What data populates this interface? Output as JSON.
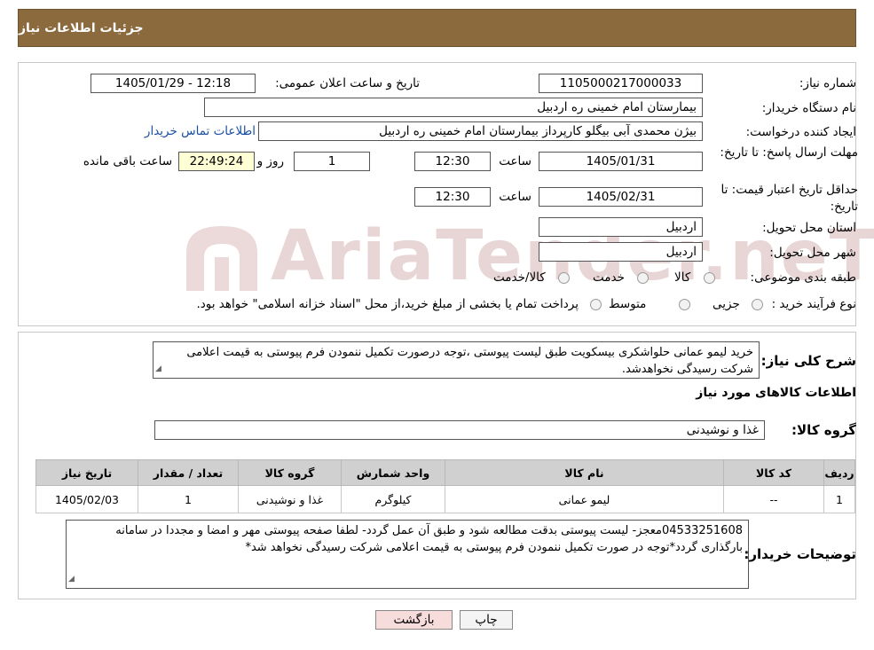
{
  "header": {
    "title": "جزئیات اطلاعات نیاز"
  },
  "form": {
    "need_number_label": "شماره نیاز:",
    "need_number": "1105000217000033",
    "announce_label": "تاریخ و ساعت اعلان عمومی:",
    "announce_value": "1405/01/29 - 12:18",
    "buyer_org_label": "نام دستگاه خریدار:",
    "buyer_org": "بیمارستان امام خمینی  ره  اردبیل",
    "creator_label": "ایجاد کننده درخواست:",
    "creator": "بیژن محمدی آبی بیگلو کارپرداز بیمارستان امام خمینی  ره  اردبیل",
    "contact_link": "اطلاعات تماس خریدار",
    "deadline_label": "مهلت ارسال پاسخ: تا تاریخ:",
    "deadline_date": "1405/01/31",
    "time_label": "ساعت",
    "deadline_time": "12:30",
    "days_value": "1",
    "days_label": "روز و",
    "remaining_time": "22:49:24",
    "remaining_label": "ساعت باقی مانده",
    "price_valid_label": "حداقل تاریخ اعتبار قیمت: تا تاریخ:",
    "price_valid_date": "1405/02/31",
    "price_valid_time": "12:30",
    "province_label": "استان محل تحویل:",
    "province": "اردبیل",
    "city_label": "شهر محل تحویل:",
    "city": "اردبیل",
    "category_label": "طبقه بندی موضوعی:",
    "category_options": [
      "کالا",
      "خدمت",
      "کالا/خدمت"
    ],
    "process_label": "نوع فرآیند خرید :",
    "process_options": [
      "جزیی",
      "متوسط"
    ],
    "process_note": "پرداخت تمام یا بخشی از مبلغ خرید،از محل \"اسناد خزانه اسلامی\" خواهد بود."
  },
  "description": {
    "label": "شرح کلی نیاز:",
    "text": "خرید لیمو عمانی حلواشکری بیسکویت طبق لیست پیوستی ،توجه درصورت تکمیل ننمودن فرم پیوستی به قیمت اعلامی شرکت رسیدگی نخواهدشد."
  },
  "goods": {
    "section_title": "اطلاعات کالاهای مورد نیاز",
    "group_label": "گروه کالا:",
    "group_value": "غذا و نوشیدنی",
    "columns": [
      "ردیف",
      "کد کالا",
      "نام کالا",
      "واحد شمارش",
      "گروه کالا",
      "تعداد / مقدار",
      "تاریخ نیاز"
    ],
    "rows": [
      [
        "1",
        "--",
        "لیمو عمانی",
        "کیلوگرم",
        "غذا و نوشیدنی",
        "1",
        "1405/02/03"
      ]
    ]
  },
  "buyer_notes": {
    "label": "توضیحات خریدار:",
    "text": "04533251608معجز- لیست پیوستی بدقت مطالعه شود و طبق آن عمل گردد- لطفا صفحه پیوستی مهر و امضا و مجددا در سامانه بارگذاری گردد*توجه در صورت تکمیل ننمودن فرم پیوستی به قیمت اعلامی شرکت رسیدگی نخواهد شد*"
  },
  "buttons": {
    "print": "چاپ",
    "back": "بازگشت"
  },
  "watermark": "AriaTender.neT",
  "colors": {
    "header_bg": "#8b6a3e",
    "link": "#1a4fa0",
    "back_btn": "#f7dcdc"
  }
}
